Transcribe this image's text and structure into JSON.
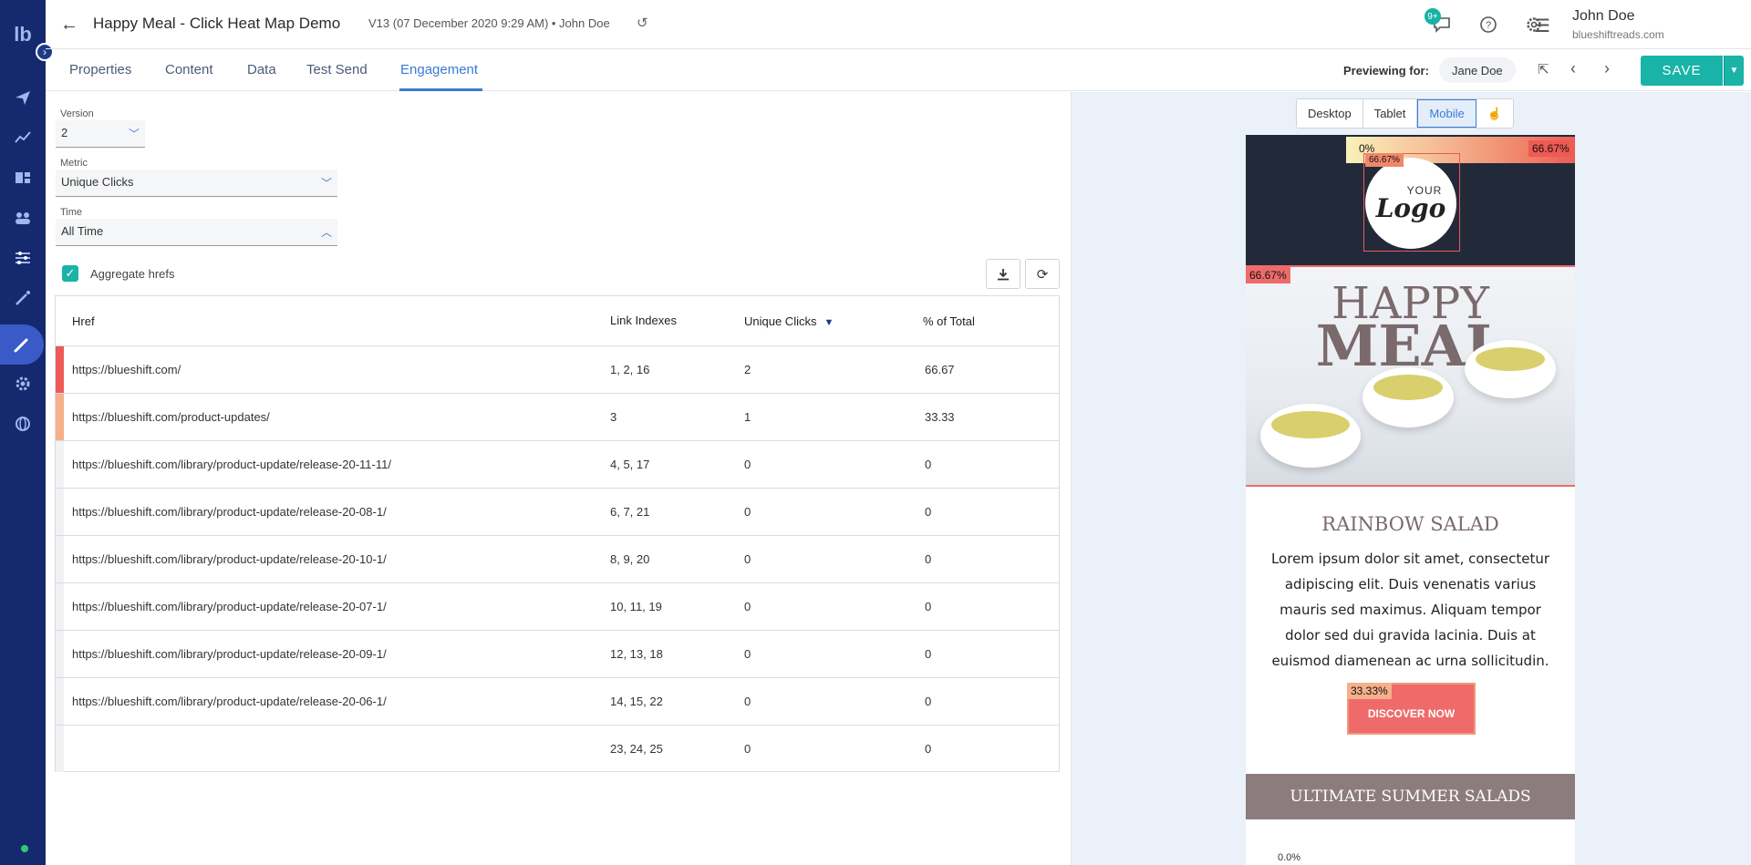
{
  "header": {
    "title": "Happy Meal - Click Heat Map Demo",
    "meta": "V13 (07 December 2020 9:29 AM)  •  John Doe",
    "notification_count": "9+",
    "user_name": "John Doe",
    "user_domain": "blueshiftreads.com",
    "logo_text": "lb"
  },
  "tabs": {
    "items": [
      "Properties",
      "Content",
      "Data",
      "Test Send",
      "Engagement"
    ],
    "active": "Engagement",
    "previewing_label": "Previewing for:",
    "previewing_user": "Jane Doe",
    "save_label": "SAVE"
  },
  "filters": {
    "version_label": "Version",
    "version_value": "2",
    "metric_label": "Metric",
    "metric_value": "Unique Clicks",
    "time_label": "Time",
    "time_value": "All Time",
    "aggregate_label": "Aggregate hrefs",
    "aggregate_checked": true
  },
  "table": {
    "columns": [
      "Href",
      "Link Indexes",
      "Unique Clicks",
      "% of Total"
    ],
    "sort_column": "Unique Clicks",
    "rows": [
      {
        "href": "https://blueshift.com/",
        "indexes": "1, 2, 16",
        "clicks": "2",
        "pct": "66.67",
        "color": "#ee5a55"
      },
      {
        "href": "https://blueshift.com/product-updates/",
        "indexes": "3",
        "clicks": "1",
        "pct": "33.33",
        "color": "#f6b08a"
      },
      {
        "href": "https://blueshift.com/library/product-update/release-20-11-11/",
        "indexes": "4, 5, 17",
        "clicks": "0",
        "pct": "0",
        "color": "#f1f2f4"
      },
      {
        "href": "https://blueshift.com/library/product-update/release-20-08-1/",
        "indexes": "6, 7, 21",
        "clicks": "0",
        "pct": "0",
        "color": "#f1f2f4"
      },
      {
        "href": "https://blueshift.com/library/product-update/release-20-10-1/",
        "indexes": "8, 9, 20",
        "clicks": "0",
        "pct": "0",
        "color": "#f1f2f4"
      },
      {
        "href": "https://blueshift.com/library/product-update/release-20-07-1/",
        "indexes": "10, 11, 19",
        "clicks": "0",
        "pct": "0",
        "color": "#f1f2f4"
      },
      {
        "href": "https://blueshift.com/library/product-update/release-20-09-1/",
        "indexes": "12, 13, 18",
        "clicks": "0",
        "pct": "0",
        "color": "#f1f2f4"
      },
      {
        "href": "https://blueshift.com/library/product-update/release-20-06-1/",
        "indexes": "14, 15, 22",
        "clicks": "0",
        "pct": "0",
        "color": "#f1f2f4"
      },
      {
        "href": "",
        "indexes": "23, 24, 25",
        "clicks": "0",
        "pct": "0",
        "color": "#f1f2f4"
      }
    ]
  },
  "preview": {
    "device_tabs": [
      "Desktop",
      "Tablet",
      "Mobile"
    ],
    "active_device": "Mobile",
    "heat_top_left": "0%",
    "heat_top_right": "66.67%",
    "heat_logo": "66.67%",
    "heat_hero": "66.67%",
    "logo_your": "YOUR",
    "logo_text": "Logo",
    "hero_line1": "HAPPY",
    "hero_line2": "MEAL",
    "section_title": "RAINBOW SALAD",
    "body_text": "Lorem ipsum dolor sit amet, consectetur adipiscing elit. Duis venenatis varius mauris sed maximus. Aliquam tempor dolor sed dui gravida lacinia. Duis at euismod diamenean ac urna sollicitudin.",
    "cta_label": "DISCOVER NOW",
    "cta_heat": "33.33%",
    "band_title": "ULTIMATE SUMMER SALADS",
    "bottom_heat": "0.0%"
  },
  "colors": {
    "accent": "#3a7bd5",
    "save": "#19b3a8",
    "sidebar": "#152a6e",
    "heat_high": "#ee5a55",
    "heat_mid": "#f6b08a",
    "heat_low": "#f9f1b8"
  }
}
